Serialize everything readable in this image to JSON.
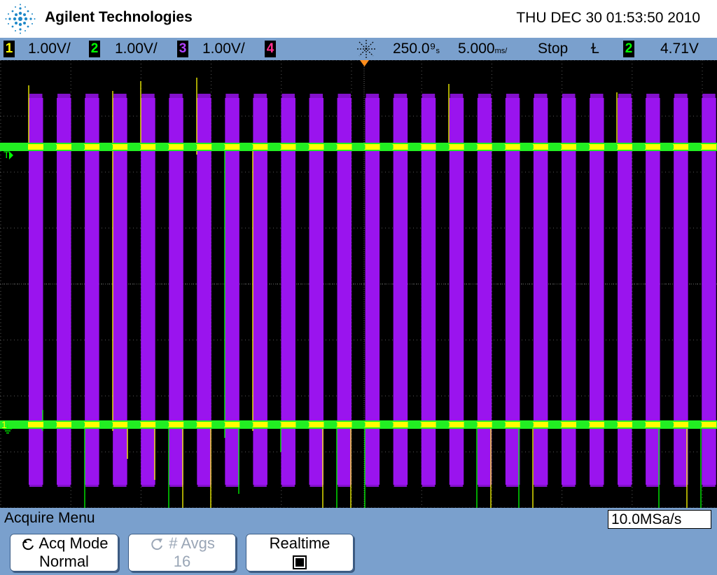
{
  "header": {
    "brand": "Agilent Technologies",
    "datetime": "THU DEC 30 01:53:50 2010"
  },
  "status_bar": {
    "channels": [
      {
        "num": "1",
        "scale": "1.00V/",
        "color": "#ffff00"
      },
      {
        "num": "2",
        "scale": "1.00V/",
        "color": "#00ff00"
      },
      {
        "num": "3",
        "scale": "1.00V/",
        "color": "#b040ff"
      },
      {
        "num": "4",
        "scale": "",
        "color": "#ff3090"
      }
    ],
    "delay": "250.0⁹",
    "delay_unit": "s",
    "timebase": "5.000",
    "timebase_unit": "ms/",
    "run_state": "Stop",
    "trigger_symbol": "Ɫ",
    "trigger_channel": "2",
    "trigger_level": "4.71V"
  },
  "screen": {
    "trigger_marker": "T",
    "ground_marker": "1"
  },
  "menu": {
    "title": "Acquire Menu",
    "sample_rate": "10.0MSa/s",
    "softkeys": [
      {
        "line1": "Acq Mode",
        "line2": "Normal",
        "enabled": true,
        "icon": "rotate-arrow-icon"
      },
      {
        "line1": "# Avgs",
        "line2": "16",
        "enabled": false,
        "icon": "rotate-arrow-icon"
      },
      {
        "line1": "Realtime",
        "line2": "",
        "enabled": true,
        "icon": "checkbox-icon"
      }
    ]
  }
}
